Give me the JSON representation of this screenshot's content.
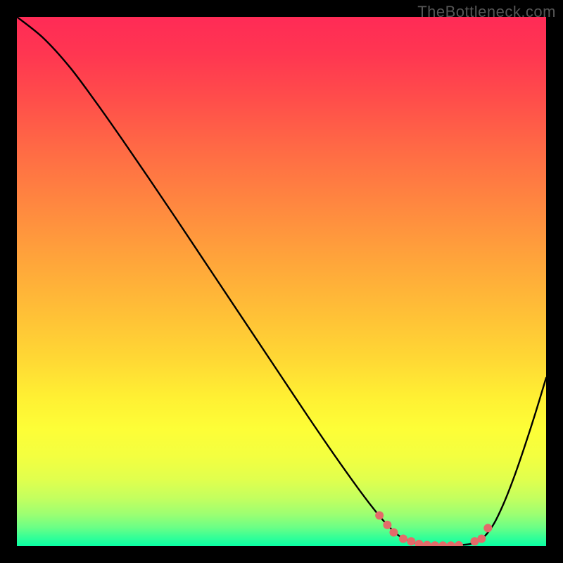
{
  "watermark": "TheBottleneck.com",
  "chart_data": {
    "type": "line",
    "title": "",
    "xlabel": "",
    "ylabel": "",
    "xlim": [
      0,
      100
    ],
    "ylim": [
      0,
      100
    ],
    "series": [
      {
        "name": "bottleneck-curve",
        "x": [
          0,
          5,
          10,
          15,
          20,
          25,
          30,
          35,
          40,
          45,
          50,
          55,
          60,
          65,
          68,
          70,
          72,
          74,
          76,
          78,
          80,
          82,
          84,
          86,
          88,
          90,
          92,
          94,
          96,
          98,
          100
        ],
        "y": [
          100,
          96,
          90.5,
          83.8,
          76.7,
          69.4,
          62,
          54.5,
          47,
          39.5,
          32,
          24.5,
          17.2,
          10.2,
          6.3,
          4,
          2.1,
          1.0,
          0.4,
          0.15,
          0.1,
          0.1,
          0.2,
          0.5,
          1.5,
          4.0,
          8.1,
          13.2,
          19.0,
          25.2,
          31.8
        ]
      }
    ],
    "markers": {
      "x": [
        68.5,
        70.0,
        71.2,
        73.0,
        74.5,
        76.0,
        77.5,
        79.0,
        80.5,
        82.0,
        83.5,
        86.5,
        87.8,
        89.0
      ],
      "y": [
        5.8,
        4.0,
        2.6,
        1.4,
        0.9,
        0.4,
        0.2,
        0.12,
        0.1,
        0.1,
        0.15,
        0.9,
        1.4,
        3.4
      ],
      "color": "#e46a6a",
      "radius": 6
    },
    "gradient_stops": [
      {
        "offset": 0.0,
        "color": "#ff2b56"
      },
      {
        "offset": 0.07,
        "color": "#ff3651"
      },
      {
        "offset": 0.15,
        "color": "#ff4c4b"
      },
      {
        "offset": 0.25,
        "color": "#ff6a45"
      },
      {
        "offset": 0.35,
        "color": "#ff8640"
      },
      {
        "offset": 0.45,
        "color": "#ffa23b"
      },
      {
        "offset": 0.55,
        "color": "#ffbd37"
      },
      {
        "offset": 0.65,
        "color": "#ffd934"
      },
      {
        "offset": 0.72,
        "color": "#fff033"
      },
      {
        "offset": 0.78,
        "color": "#fdfe37"
      },
      {
        "offset": 0.83,
        "color": "#f3ff40"
      },
      {
        "offset": 0.875,
        "color": "#e0ff4e"
      },
      {
        "offset": 0.91,
        "color": "#c3ff5f"
      },
      {
        "offset": 0.94,
        "color": "#9cff72"
      },
      {
        "offset": 0.965,
        "color": "#6aff86"
      },
      {
        "offset": 0.985,
        "color": "#30ff98"
      },
      {
        "offset": 1.0,
        "color": "#0affa4"
      }
    ],
    "curve_color": "#000000",
    "curve_width": 2.4
  }
}
